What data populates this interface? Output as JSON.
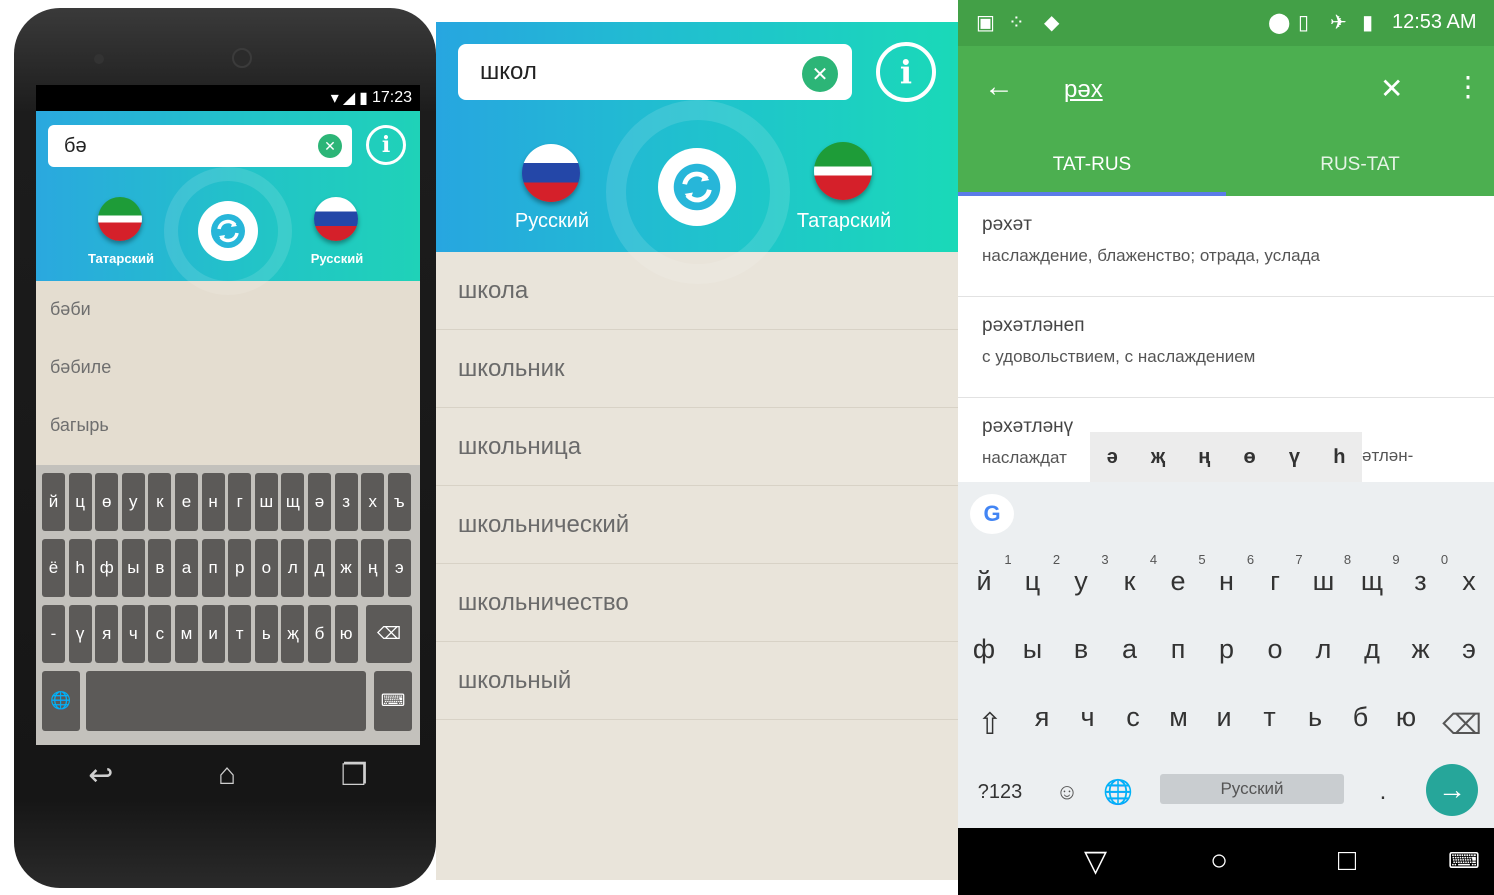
{
  "panel1": {
    "status_time": "17:23",
    "search_value": "бә",
    "clear_icon": "clear-icon",
    "info_icon": "info-icon",
    "lang_from": "Татарский",
    "lang_to": "Русский",
    "suggestions": [
      "бәби",
      "бәбиле",
      "багырь"
    ],
    "keyboard": {
      "row1": [
        "й",
        "ц",
        "ө",
        "у",
        "к",
        "е",
        "н",
        "г",
        "ш",
        "щ",
        "ә",
        "з",
        "х",
        "ъ"
      ],
      "row2": [
        "ё",
        "һ",
        "ф",
        "ы",
        "в",
        "а",
        "п",
        "р",
        "о",
        "л",
        "д",
        "ж",
        "ң",
        "э"
      ],
      "row3": [
        "-",
        "ү",
        "я",
        "ч",
        "с",
        "м",
        "и",
        "т",
        "ь",
        "җ",
        "б",
        "ю"
      ],
      "globe_icon": "globe-icon",
      "backspace_icon": "backspace-icon",
      "keyboard_hide_icon": "keyboard-icon"
    }
  },
  "panel2": {
    "search_value": "школ",
    "lang_from": "Русский",
    "lang_to": "Татарский",
    "results": [
      "школа",
      "школьник",
      "школьница",
      "школьнический",
      "школьничество",
      "школьный"
    ]
  },
  "panel3": {
    "status_time": "12:53 AM",
    "search_value": "рәх",
    "tabs": [
      "TAT-RUS",
      "RUS-TAT"
    ],
    "active_tab": "TAT-RUS",
    "results": [
      {
        "word": "рәхәт",
        "translation": "наслаждение, блаженство; отрада, услада"
      },
      {
        "word": "рәхәтләнеп",
        "translation": "с удовольствием, с наслаждением"
      },
      {
        "word": "рәхәтләнү",
        "translation": "наслаждат",
        "translation_tail": "әтлән-"
      }
    ],
    "extra_keys": [
      "ә",
      "җ",
      "ң",
      "ө",
      "ү",
      "һ"
    ],
    "keyboard": {
      "digits": [
        "1",
        "2",
        "3",
        "4",
        "5",
        "6",
        "7",
        "8",
        "9",
        "0"
      ],
      "row1": [
        "й",
        "ц",
        "у",
        "к",
        "е",
        "н",
        "г",
        "ш",
        "щ",
        "з",
        "х"
      ],
      "row2": [
        "ф",
        "ы",
        "в",
        "а",
        "п",
        "р",
        "о",
        "л",
        "д",
        "ж",
        "э"
      ],
      "row3": [
        "я",
        "ч",
        "с",
        "м",
        "и",
        "т",
        "ь",
        "б",
        "ю"
      ],
      "symbols_label": "?123",
      "space_label": "Русский",
      "period": "."
    }
  }
}
